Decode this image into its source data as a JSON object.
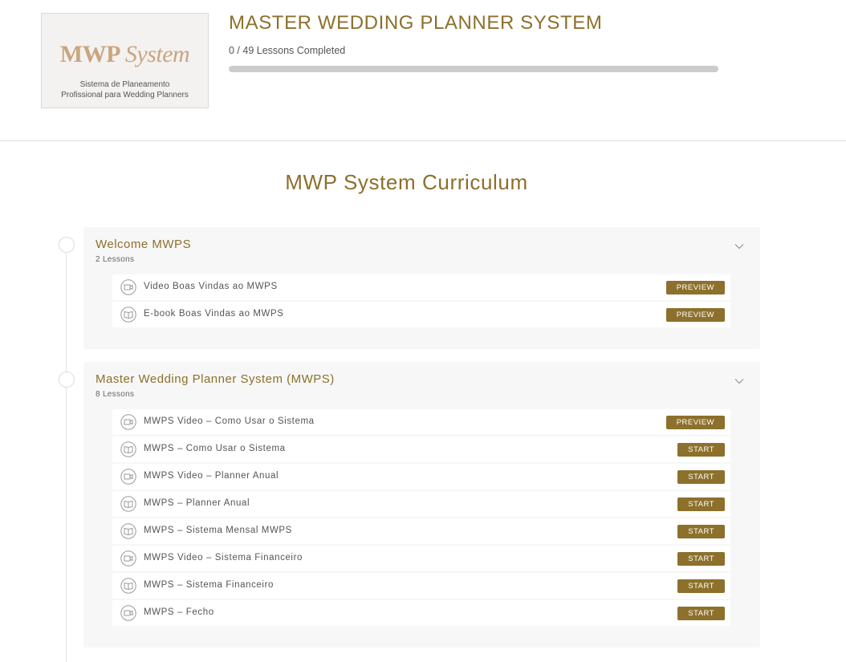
{
  "header": {
    "logo": {
      "mark_bold": "MWP",
      "mark_italic": "System",
      "subtitle_line1": "Sistema de Planeamento",
      "subtitle_line2": "Profissional para Wedding Planners"
    },
    "course_title": "MASTER WEDDING PLANNER SYSTEM",
    "progress_text": "0 / 49 Lessons Completed",
    "progress_percent": 0
  },
  "curriculum": {
    "title": "MWP System Curriculum",
    "sections": [
      {
        "title": "Welcome MWPS",
        "count": "2 Lessons",
        "lessons": [
          {
            "title": "Video Boas Vindas ao MWPS",
            "icon": "video-icon",
            "button": "PREVIEW"
          },
          {
            "title": "E-book Boas Vindas ao MWPS",
            "icon": "book-icon",
            "button": "PREVIEW"
          }
        ]
      },
      {
        "title": "Master Wedding Planner System (MWPS)",
        "count": "8 Lessons",
        "lessons": [
          {
            "title": "MWPS Video – Como Usar o Sistema",
            "icon": "video-icon",
            "button": "PREVIEW"
          },
          {
            "title": "MWPS – Como Usar o Sistema",
            "icon": "book-icon",
            "button": "START"
          },
          {
            "title": "MWPS Video – Planner Anual",
            "icon": "video-icon",
            "button": "START"
          },
          {
            "title": "MWPS – Planner Anual",
            "icon": "book-icon",
            "button": "START"
          },
          {
            "title": "MWPS – Sistema Mensal MWPS",
            "icon": "book-icon",
            "button": "START"
          },
          {
            "title": "MWPS Video – Sistema Financeiro",
            "icon": "video-icon",
            "button": "START"
          },
          {
            "title": "MWPS – Sistema Financeiro",
            "icon": "book-icon",
            "button": "START"
          },
          {
            "title": "MWPS – Fecho",
            "icon": "video-icon",
            "button": "START"
          }
        ]
      }
    ]
  },
  "colors": {
    "accent": "#8c702b",
    "logo_gold": "#c9a581",
    "section_bg": "#f7f7f7",
    "progress_track": "#cccccc"
  }
}
